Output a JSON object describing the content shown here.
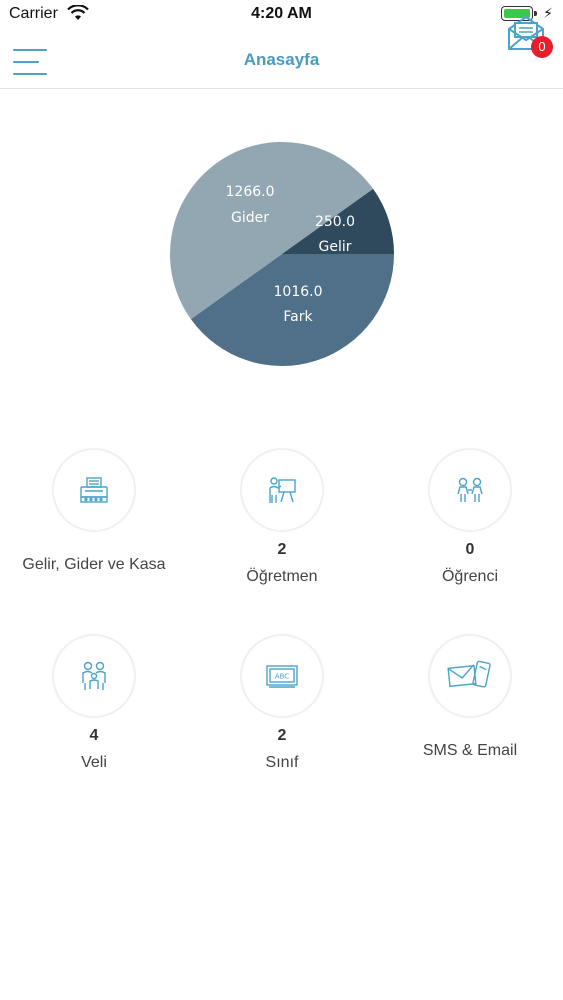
{
  "status_bar": {
    "carrier": "Carrier",
    "time": "4:20 AM"
  },
  "nav": {
    "title": "Anasayfa",
    "mail_badge": "0"
  },
  "chart_data": {
    "type": "pie",
    "slices": [
      {
        "name": "Gider",
        "value_label": "1266.0",
        "value": 1266.0,
        "color": "#93a7b3"
      },
      {
        "name": "Gelir",
        "value_label": "250.0",
        "value": 250.0,
        "color": "#2e4a5c"
      },
      {
        "name": "Fark",
        "value_label": "1016.0",
        "value": 1016.0,
        "color": "#4f7088"
      }
    ]
  },
  "menu": [
    {
      "icon": "cash-register-icon",
      "count": "",
      "label": "Gelir, Gider ve Kasa"
    },
    {
      "icon": "teacher-icon",
      "count": "2",
      "label": "Öğretmen"
    },
    {
      "icon": "students-icon",
      "count": "0",
      "label": "Öğrenci"
    },
    {
      "icon": "parents-icon",
      "count": "4",
      "label": "Veli"
    },
    {
      "icon": "classroom-board-icon",
      "count": "2",
      "label": "Sınıf"
    },
    {
      "icon": "sms-email-icon",
      "count": "",
      "label": "SMS & Email"
    }
  ],
  "colors": {
    "accent": "#4a9bc0",
    "badge": "#e5202a",
    "icon": "#4aa3c9"
  }
}
